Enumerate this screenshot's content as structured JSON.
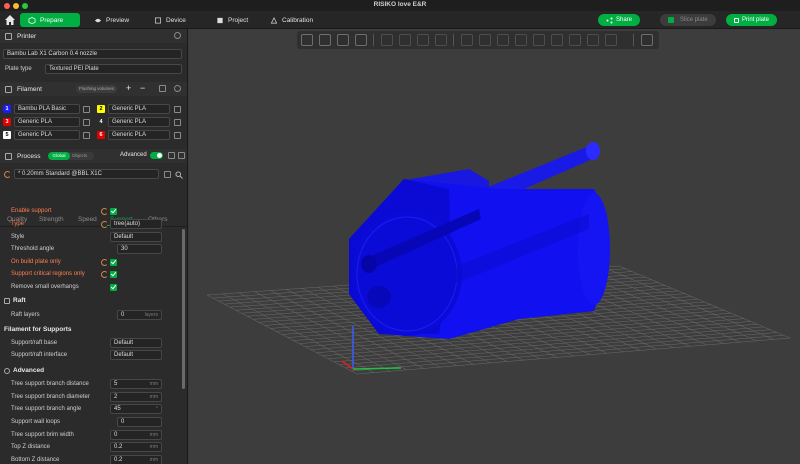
{
  "window": {
    "title": "RISIKO love E&R"
  },
  "nav": {
    "tabs": [
      {
        "label": "Prepare",
        "icon": "cube-icon"
      },
      {
        "label": "Preview",
        "icon": "eye-icon"
      },
      {
        "label": "Device",
        "icon": "device-icon"
      },
      {
        "label": "Project",
        "icon": "project-icon"
      },
      {
        "label": "Calibration",
        "icon": "calibration-icon"
      }
    ],
    "share_label": "Share",
    "slice_label": "Slice plate",
    "print_label": "Print plate"
  },
  "printer": {
    "heading": "Printer",
    "name": "Bambu Lab X1 Carbon 0.4 nozzle",
    "plate_type_label": "Plate type",
    "plate_type": "Textured PEI Plate"
  },
  "filament": {
    "heading": "Filament",
    "flushing_label": "Flushing volumes",
    "slots": [
      {
        "num": "1",
        "name": "Bambu PLA Basic",
        "color": "#1a1aff",
        "text": "#ffffff"
      },
      {
        "num": "2",
        "name": "Generic PLA",
        "color": "#ffff00",
        "text": "#000000"
      },
      {
        "num": "3",
        "name": "Generic PLA",
        "color": "#e00000",
        "text": "#ffffff"
      },
      {
        "num": "4",
        "name": "Generic PLA",
        "color": "#2b2b2b",
        "text": "#ffffff"
      },
      {
        "num": "5",
        "name": "Generic PLA",
        "color": "#ffffff",
        "text": "#000000"
      },
      {
        "num": "6",
        "name": "Generic PLA",
        "color": "#e00000",
        "text": "#ffffff"
      }
    ]
  },
  "process": {
    "heading": "Process",
    "global_label": "Global",
    "objects_label": "Objects",
    "advanced_label": "Advanced",
    "preset": "* 0.20mm Standard @BBL X1C",
    "tabs": [
      "Quality",
      "Strength",
      "Speed",
      "Support",
      "Others"
    ],
    "active_tab": "Support"
  },
  "support": {
    "enable_support": "Enable support",
    "type_label": "Type",
    "type_value": "tree(auto)",
    "style_label": "Style",
    "style_value": "Default",
    "threshold_label": "Threshold angle",
    "threshold_value": "30",
    "on_build_plate": "On build plate only",
    "critical_regions": "Support critical regions only",
    "small_overhangs": "Remove small overhangs"
  },
  "raft": {
    "heading": "Raft",
    "layers_label": "Raft layers",
    "layers_value": "0",
    "layers_unit": "layers"
  },
  "filament_supports": {
    "heading": "Filament for Supports",
    "base_label": "Support/raft base",
    "base_value": "Default",
    "interface_label": "Support/raft interface",
    "interface_value": "Default"
  },
  "advanced": {
    "heading": "Advanced",
    "rows": [
      {
        "label": "Tree support branch distance",
        "value": "5",
        "unit": "mm"
      },
      {
        "label": "Tree support branch diameter",
        "value": "2",
        "unit": "mm"
      },
      {
        "label": "Tree support branch angle",
        "value": "45",
        "unit": "°"
      },
      {
        "label": "Support wall loops",
        "value": "0",
        "unit": ""
      },
      {
        "label": "Tree support brim width",
        "value": "0",
        "unit": "mm"
      },
      {
        "label": "Top Z distance",
        "value": "0.2",
        "unit": "mm"
      },
      {
        "label": "Bottom Z distance",
        "value": "0.2",
        "unit": "mm"
      }
    ]
  },
  "colors": {
    "accent": "#00ae42",
    "model": "#1010f0",
    "changed": "#ff7f50"
  }
}
